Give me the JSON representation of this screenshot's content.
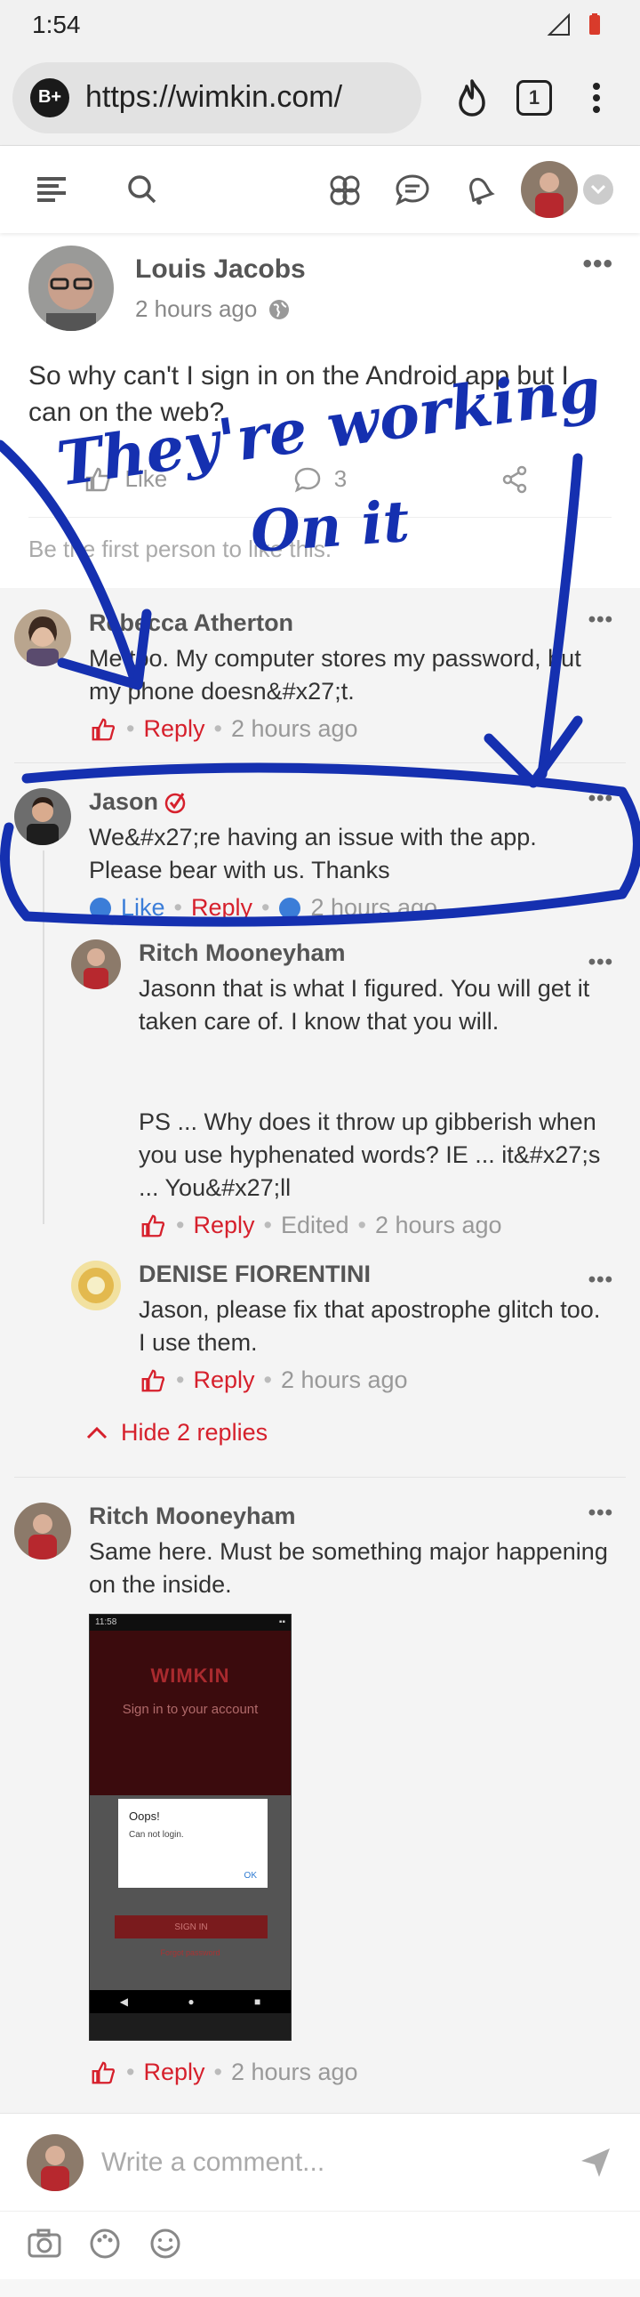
{
  "status_bar": {
    "time": "1:54",
    "signal_label": "4G"
  },
  "browser": {
    "site_badge": "B+",
    "url": "https://wimkin.com/",
    "tab_count": "1"
  },
  "post": {
    "author": "Louis Jacobs",
    "time": "2 hours ago",
    "text": "So why can't I sign in on the Android app but I can on the web?",
    "like_label": "Like",
    "comment_count": "3",
    "like_summary": "Be the first person to like this."
  },
  "annotation": {
    "line1": "They're working",
    "line2": "On it"
  },
  "comments": [
    {
      "author": "Rebecca Atherton",
      "text": "Me too. My computer stores my password, but my phone doesn&#x27;t.",
      "reply_label": "Reply",
      "time": "2 hours ago"
    },
    {
      "author": "Jason",
      "text": "We&#x27;re having an issue with the app. Please bear with us. Thanks",
      "like_label": "Like",
      "reply_label": "Reply",
      "time": "2 hours ago"
    },
    {
      "author": "Ritch Mooneyham",
      "text1": "Jasonn that is what I figured. You will get it taken care of. I know that you will.",
      "text2": "PS ... Why does it throw up gibberish when you use hyphenated words? IE ... it&#x27;s ... You&#x27;ll",
      "reply_label": "Reply",
      "edited": "Edited",
      "time": "2 hours ago"
    },
    {
      "author": "DENISE FIORENTINI",
      "text": "Jason, please fix that apostrophe glitch too. I use them.",
      "reply_label": "Reply",
      "time": "2 hours ago"
    },
    {
      "author": "Ritch Mooneyham",
      "text": "Same here. Must be something major happening on the inside.",
      "reply_label": "Reply",
      "time": "2 hours ago"
    }
  ],
  "hide_replies": "Hide 2 replies",
  "attachment": {
    "status_time": "11:58",
    "logo": "WIMKIN",
    "subtitle": "Sign in to your account",
    "dialog_title": "Oops!",
    "dialog_message": "Can not login.",
    "dialog_ok": "OK",
    "signin_button": "SIGN IN",
    "forgot": "Forgot password"
  },
  "compose": {
    "placeholder": "Write a comment..."
  },
  "colors": {
    "accent": "#d6202c",
    "ink": "#1530b0",
    "background": "#f4f4f4"
  }
}
